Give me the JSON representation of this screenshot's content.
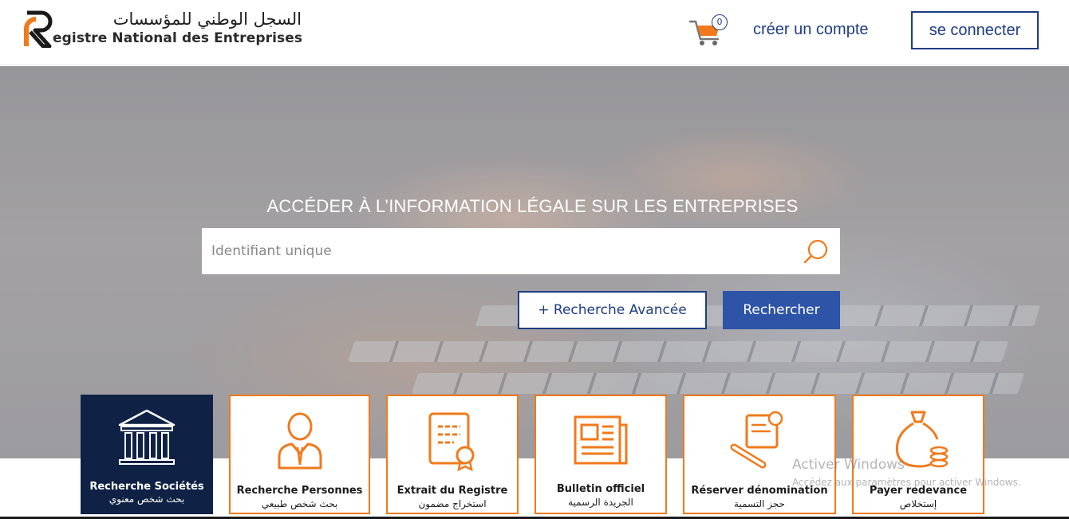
{
  "brand": {
    "arabic_name": "السجل الوطني للمؤسسات",
    "french_name": "egistre National des Entreprises",
    "accent_color": "#f07a1c",
    "primary_color": "#1e3d84"
  },
  "header": {
    "cart_count": "0",
    "create_account_label": "créer un compte",
    "login_label": "se connecter"
  },
  "hero": {
    "title": "ACCÉDER À L’INFORMATION LÉGALE SUR LES ENTREPRISES",
    "search_placeholder": "Identifiant unique",
    "search_value": "",
    "advanced_search_label": "+ Recherche Avancée",
    "search_button_label": "Rechercher"
  },
  "tiles": [
    {
      "label": "Recherche Sociétés",
      "sub": "بحث شخص معنوي",
      "icon": "building-columns-icon",
      "active": true
    },
    {
      "label": "Recherche Personnes",
      "sub": "بحث شخص طبيعي",
      "icon": "person-icon",
      "active": false
    },
    {
      "label": "Extrait du Registre",
      "sub": "استخراج مضمون",
      "icon": "certificate-icon",
      "active": false
    },
    {
      "label": "Bulletin officiel",
      "sub": "الجريدة الرسمية",
      "icon": "newspaper-icon",
      "active": false
    },
    {
      "label": "Réserver dénomination",
      "sub": "حجز التسمية",
      "icon": "document-seal-icon",
      "active": false
    },
    {
      "label": "Payer redevance",
      "sub": "إستخلاص",
      "icon": "money-bag-icon",
      "active": false
    }
  ],
  "watermark": {
    "line1": "Activer Windows",
    "line2": "Accédez aux paramètres pour activer Windows."
  }
}
